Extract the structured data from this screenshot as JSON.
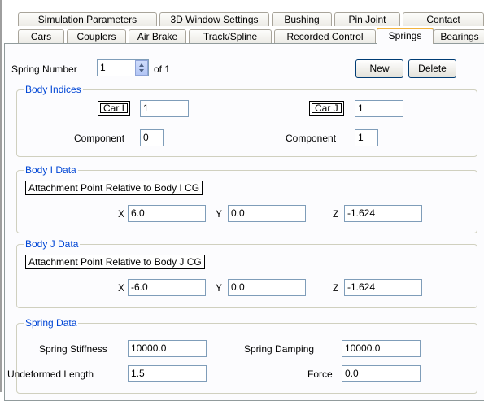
{
  "tabs_row1": [
    "Simulation Parameters",
    "3D Window Settings",
    "Bushing",
    "Pin Joint",
    "Contact"
  ],
  "tabs_row2": [
    "Cars",
    "Couplers",
    "Air Brake",
    "Track/Spline",
    "Recorded Control",
    "Springs",
    "Bearings"
  ],
  "active_tab": "Springs",
  "spring_number": {
    "label": "Spring Number",
    "value": "1",
    "of_text": "of 1"
  },
  "buttons": {
    "new": "New",
    "delete": "Delete"
  },
  "body_indices": {
    "title": "Body Indices",
    "car_i_label": "Car I",
    "car_i_value": "1",
    "car_j_label": "Car J",
    "car_j_value": "1",
    "component_label": "Component",
    "component_i_value": "0",
    "component_j_value": "1"
  },
  "body_i": {
    "title": "Body I Data",
    "attach_label": "Attachment Point Relative to Body I CG",
    "x_label": "X",
    "x": "6.0",
    "y_label": "Y",
    "y": "0.0",
    "z_label": "Z",
    "z": "-1.624"
  },
  "body_j": {
    "title": "Body J Data",
    "attach_label": "Attachment Point Relative to Body J CG",
    "x_label": "X",
    "x": "-6.0",
    "y_label": "Y",
    "y": "0.0",
    "z_label": "Z",
    "z": "-1.624"
  },
  "spring_data": {
    "title": "Spring Data",
    "stiffness_label": "Spring Stiffness",
    "stiffness": "10000.0",
    "damping_label": "Spring Damping",
    "damping": "10000.0",
    "undeformed_label": "Undeformed Length",
    "undeformed": "1.5",
    "force_label": "Force",
    "force": "0.0"
  },
  "colors": {
    "legend": "#0046d5",
    "active_tab_highlight": "#f2b33d",
    "panel_bg": "#fcfcfe"
  }
}
